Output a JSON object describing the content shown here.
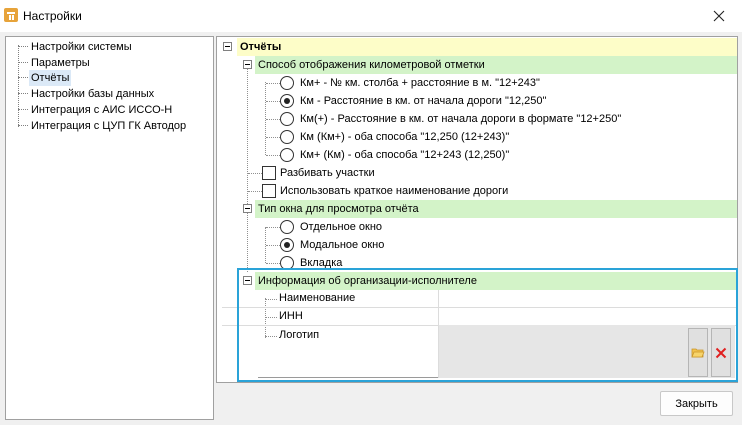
{
  "window": {
    "title": "Настройки",
    "icon": "road-sign-icon"
  },
  "sidebar": {
    "items": [
      {
        "label": "Настройки системы",
        "selected": false
      },
      {
        "label": "Параметры",
        "selected": false
      },
      {
        "label": "Отчёты",
        "selected": true
      },
      {
        "label": "Настройки базы данных",
        "selected": false
      },
      {
        "label": "Интеграция с АИС ИССО-Н",
        "selected": false
      },
      {
        "label": "Интеграция с ЦУП ГК Автодор",
        "selected": false
      }
    ]
  },
  "grid": {
    "title": "Отчёты",
    "km_section": {
      "title": "Способ отображения километровой отметки",
      "options": [
        {
          "label": "Км+ - № км. столба + расстояние в м. \"12+243\"",
          "checked": false
        },
        {
          "label": "Км - Расстояние в км. от начала дороги \"12,250\"",
          "checked": true
        },
        {
          "label": "Км(+) - Расстояние в км. от начала дороги в формате \"12+250\"",
          "checked": false
        },
        {
          "label": "Км (Км+) - оба способа \"12,250 (12+243)\"",
          "checked": false
        },
        {
          "label": "Км+ (Км) - оба способа \"12+243 (12,250)\"",
          "checked": false
        }
      ]
    },
    "checkboxes": [
      {
        "label": "Разбивать участки",
        "checked": false
      },
      {
        "label": "Использовать краткое наименование дороги",
        "checked": false
      }
    ],
    "window_section": {
      "title": "Тип окна для просмотра отчёта",
      "options": [
        {
          "label": "Отдельное окно",
          "checked": false
        },
        {
          "label": "Модальное окно",
          "checked": true
        },
        {
          "label": "Вкладка",
          "checked": false
        }
      ]
    },
    "org_section": {
      "title": "Информация об организации-исполнителе",
      "fields": [
        {
          "label": "Наименование",
          "value": ""
        },
        {
          "label": "ИНН",
          "value": ""
        },
        {
          "label": "Логотип",
          "value": ""
        }
      ],
      "open_icon": "folder-open-icon",
      "clear_icon": "delete-x-icon"
    }
  },
  "footer": {
    "close_label": "Закрыть"
  },
  "colors": {
    "category_bg": "#d3f3c8",
    "top_category_bg": "#fdfdc8",
    "selection_bg": "#dbe9f7",
    "focus_border": "#2aa3d8"
  }
}
